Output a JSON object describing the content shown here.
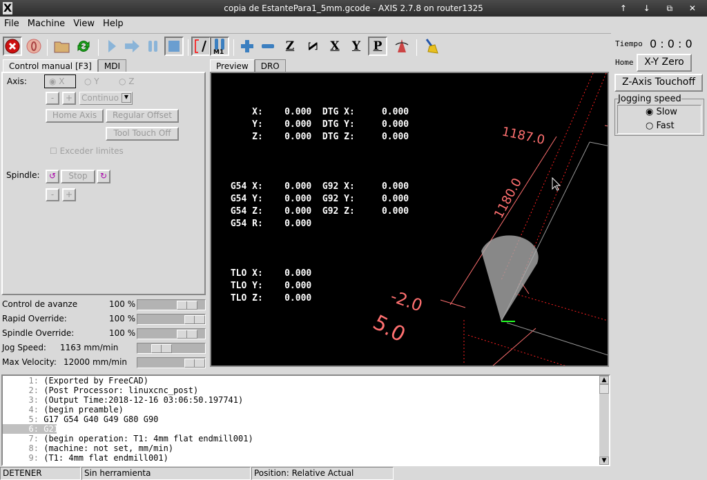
{
  "window": {
    "title": "copia de EstantePara1_5mm.gcode - AXIS 2.7.8 on router1325",
    "controls": "↑ ↓ ⧉ ✕"
  },
  "menu": [
    "File",
    "Machine",
    "View",
    "Help"
  ],
  "toolbar": [
    {
      "icon": "estop-icon",
      "color": "#cc0000"
    },
    {
      "icon": "power-icon"
    },
    {
      "icon": "open-file-icon"
    },
    {
      "icon": "reload-icon"
    },
    {
      "icon": "run-icon"
    },
    {
      "icon": "step-icon"
    },
    {
      "icon": "pause-icon"
    },
    {
      "icon": "stop-icon"
    },
    {
      "icon": "block-delete-icon"
    },
    {
      "icon": "optional-stop-icon",
      "text": "M1"
    },
    {
      "icon": "zoom-in-icon"
    },
    {
      "icon": "zoom-out-icon"
    },
    {
      "icon": "view-z-icon",
      "text": "Z"
    },
    {
      "icon": "view-z-rotated-icon",
      "text": "Z"
    },
    {
      "icon": "view-x-icon",
      "text": "X"
    },
    {
      "icon": "view-y-icon",
      "text": "Y"
    },
    {
      "icon": "view-p-icon",
      "text": "P"
    },
    {
      "icon": "rotate-view-icon"
    },
    {
      "icon": "clear-plot-icon"
    }
  ],
  "left_tabs": [
    "Control manual [F3]",
    "MDI"
  ],
  "manual": {
    "axis_label": "Axis:",
    "axes": [
      "X",
      "Y",
      "Z"
    ],
    "selected_axis": "X",
    "minus": "-",
    "plus": "+",
    "increment": "Continuo",
    "home_axis": "Home Axis",
    "regular_offset": "Regular Offset",
    "tool_touch_off": "Tool Touch Off",
    "override_limits": "Exceder limites",
    "spindle_label": "Spindle:",
    "spindle_stop": "Stop"
  },
  "overrides": [
    {
      "label": "Control de avanze",
      "value": "100 %",
      "level": 0.72
    },
    {
      "label": "Rapid Override:",
      "value": "100 %",
      "level": 1.0
    },
    {
      "label": "Spindle Override:",
      "value": "100 %",
      "level": 0.72
    },
    {
      "label": "Jog Speed:",
      "value": "1163 mm/min",
      "level": 0.22
    },
    {
      "label": "Max Velocity:",
      "value": "12000 mm/min",
      "level": 1.0
    }
  ],
  "preview_tabs": [
    "Preview",
    "DRO"
  ],
  "dro": {
    "lines": [
      "     X:    0.000  DTG X:     0.000",
      "     Y:    0.000  DTG Y:     0.000",
      "     Z:    0.000  DTG Z:     0.000",
      "",
      " G54 X:    0.000  G92 X:     0.000",
      " G54 Y:    0.000  G92 Y:     0.000",
      " G54 Z:    0.000  G92 Z:     0.000",
      " G54 R:    0.000",
      "",
      " TLO X:    0.000",
      " TLO Y:    0.000",
      " TLO Z:    0.000"
    ]
  },
  "preview_dims": [
    "1187.0",
    "1180.0",
    "-2.0",
    "5.0"
  ],
  "right": {
    "tiempo_label": "Tiempo",
    "tiempo_value": "0 : 0 : 0",
    "home_label": "Home",
    "xy_zero": "X-Y Zero",
    "z_touchoff": "Z-Axis Touchoff",
    "jog_title": "Jogging speed",
    "jog_options": [
      "Slow",
      "Fast"
    ],
    "jog_selected": "Slow"
  },
  "gcode": [
    {
      "n": "1:",
      "t": "(Exported by FreeCAD)"
    },
    {
      "n": "2:",
      "t": "(Post Processor: linuxcnc_post)"
    },
    {
      "n": "3:",
      "t": "(Output Time:2018-12-16 03:06:50.197741)"
    },
    {
      "n": "4:",
      "t": "(begin preamble)"
    },
    {
      "n": "5:",
      "t": "G17 G54 G40 G49 G80 G90"
    },
    {
      "n": "6:",
      "t": "G21",
      "selected": true
    },
    {
      "n": "7:",
      "t": "(begin operation: T1: 4mm flat endmill001)"
    },
    {
      "n": "8:",
      "t": "(machine: not set, mm/min)"
    },
    {
      "n": "9:",
      "t": "(T1: 4mm flat endmill001)"
    }
  ],
  "status": {
    "state": "DETENER",
    "tool": "Sin herramienta",
    "position": "Position: Relative Actual"
  }
}
